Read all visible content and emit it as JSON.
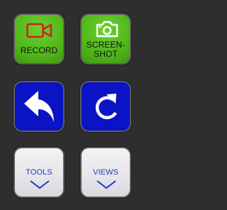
{
  "buttons": {
    "record": {
      "label": "RECORD",
      "icon": "video-camera-icon"
    },
    "screenshot": {
      "label": "SCREEN-\nSHOT",
      "line1": "SCREEN-",
      "line2": "SHOT",
      "icon": "camera-icon"
    },
    "undo": {
      "icon": "undo-arrow-icon"
    },
    "redo": {
      "icon": "redo-circular-arrow-icon"
    },
    "tools": {
      "label": "TOOLS",
      "icon": "chevron-down-icon"
    },
    "views": {
      "label": "VIEWS",
      "icon": "chevron-down-icon"
    }
  },
  "colors": {
    "background": "#2e2e2e",
    "green": "#52b61c",
    "blue": "#0a14c4",
    "gray": "#e6e6ea",
    "record_icon": "#d22020",
    "accent_label": "#1a3cc0"
  }
}
